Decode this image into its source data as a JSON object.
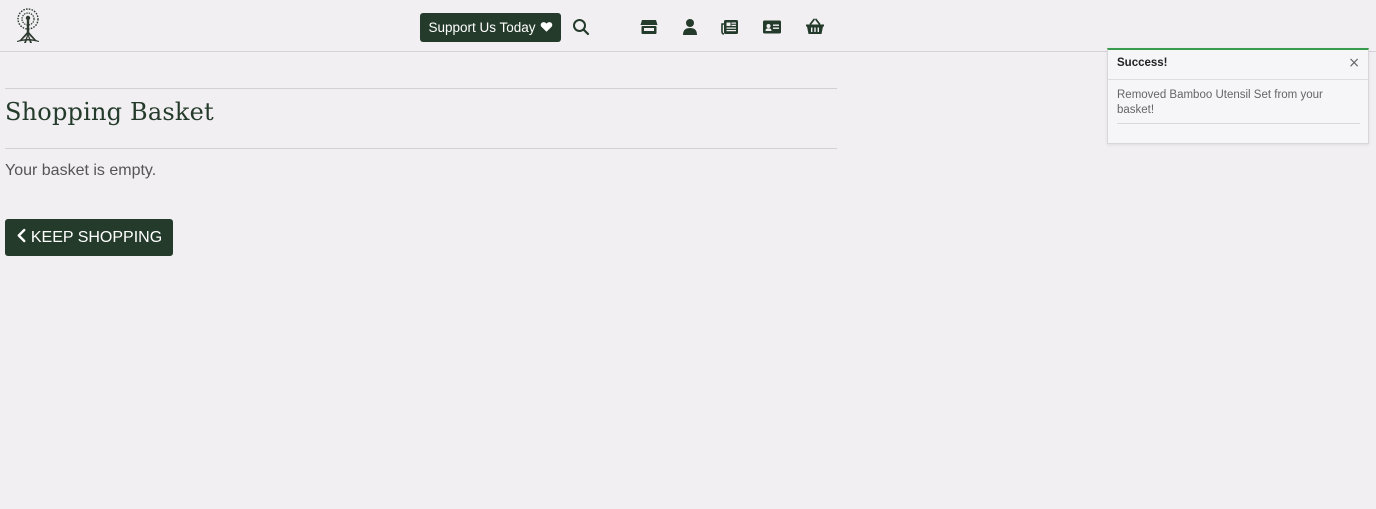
{
  "header": {
    "logo_icon": "tree-logo-icon",
    "support_label": "Support Us Today",
    "support_icon": "heart-icon",
    "nav_icons": [
      "search-icon",
      "shop-icon",
      "user-icon",
      "newspaper-icon",
      "contact-card-icon",
      "basket-icon"
    ]
  },
  "main": {
    "title": "Shopping Basket",
    "empty_message": "Your basket is empty.",
    "keep_shopping_label": "KEEP SHOPPING"
  },
  "toast": {
    "title": "Success!",
    "close_glyph": "×",
    "message": "Removed Bamboo Utensil Set from your basket!",
    "accent_color": "#3a9a4d"
  },
  "colors": {
    "brand": "#243b2b",
    "background": "#f1eff2"
  }
}
